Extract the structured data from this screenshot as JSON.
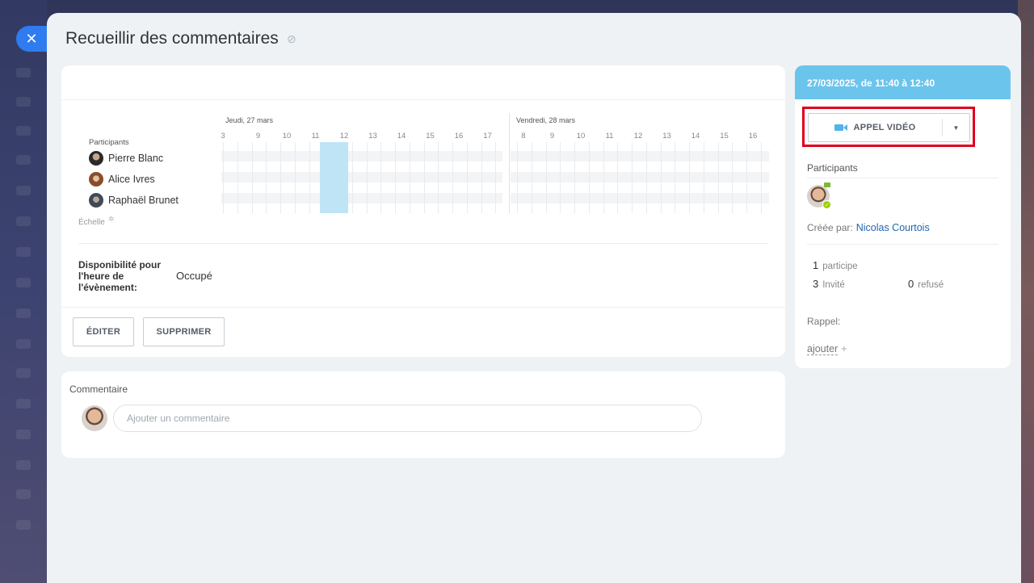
{
  "close_button": {
    "label": "✕"
  },
  "header": {
    "title": "Recueillir des commentaires",
    "link_icon": "link-icon"
  },
  "planner": {
    "participants_label": "Participants",
    "days": [
      {
        "label": "Jeudi, 27 mars",
        "hours": [
          "3",
          "9",
          "10",
          "11",
          "12",
          "13",
          "14",
          "15",
          "16",
          "17"
        ]
      },
      {
        "label": "Vendredi, 28 mars",
        "hours": [
          "8",
          "9",
          "10",
          "11",
          "12",
          "13",
          "14",
          "15",
          "16"
        ]
      }
    ],
    "participants": [
      {
        "name": "Pierre Blanc"
      },
      {
        "name": "Alice Ivres"
      },
      {
        "name": "Raphaël Brunet"
      }
    ],
    "scale_label": "Échelle",
    "selected_hour": "12"
  },
  "availability": {
    "label": "Disponibilité pour l'heure de l'évènement:",
    "value": "Occupé"
  },
  "actions": {
    "edit_label": "ÉDITER",
    "delete_label": "SUPPRIMER"
  },
  "comments": {
    "label": "Commentaire",
    "input_placeholder": "Ajouter un commentaire"
  },
  "side": {
    "date_range": "27/03/2025, de 11:40 à 12:40",
    "video_call_label": "APPEL VIDÉO",
    "participants_label": "Participants",
    "created_by_label": "Créée par:",
    "created_by_name": "Nicolas Courtois",
    "stats": {
      "attending_count": "1",
      "attending_label": "participe",
      "invited_count": "3",
      "invited_label": "Invité",
      "refused_count": "0",
      "refused_label": "refusé"
    },
    "reminder_label": "Rappel:",
    "add_label": "ajouter",
    "add_plus": "+"
  },
  "colors": {
    "accent": "#2f7bf0",
    "header_bar": "#6bc4ec",
    "highlight": "#e0001b",
    "selection": "#bfe4f6",
    "link": "#2067b0"
  }
}
